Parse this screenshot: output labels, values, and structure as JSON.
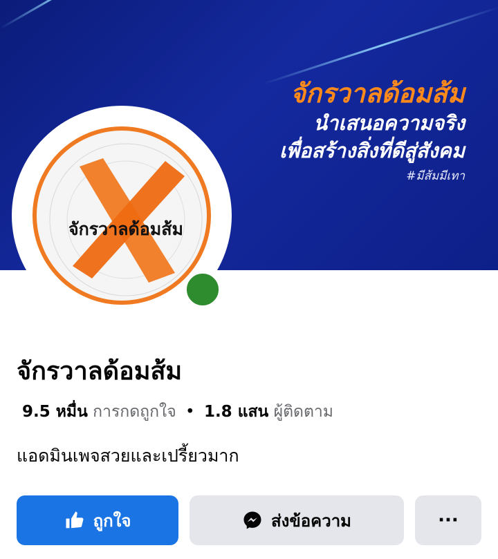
{
  "cover": {
    "title": "จักรวาลด้อมส้ม",
    "line1": "นำเสนอความจริง",
    "line2": "เพื่อสร้างสิ่งที่ดีสู่สังคม",
    "hashtag": "#มีส้มมีเทา"
  },
  "avatar": {
    "label": "จักรวาลด้อมส้ม",
    "online_status_color": "#2e8b2e"
  },
  "page": {
    "name": "จักรวาลด้อมส้ม",
    "likes_count": "9.5 หมื่น",
    "likes_label": "การกดถูกใจ",
    "separator": "•",
    "followers_count": "1.8 แสน",
    "followers_label": "ผู้ติดตาม",
    "bio": "แอดมินเพจสวยและเปรี้ยวมาก"
  },
  "actions": {
    "like_label": "ถูกใจ",
    "message_label": "ส่งข้อความ",
    "more_label": "···"
  },
  "colors": {
    "accent": "#1b74e4",
    "orange": "#f07a21",
    "cover_bg": "#0d1f88"
  }
}
